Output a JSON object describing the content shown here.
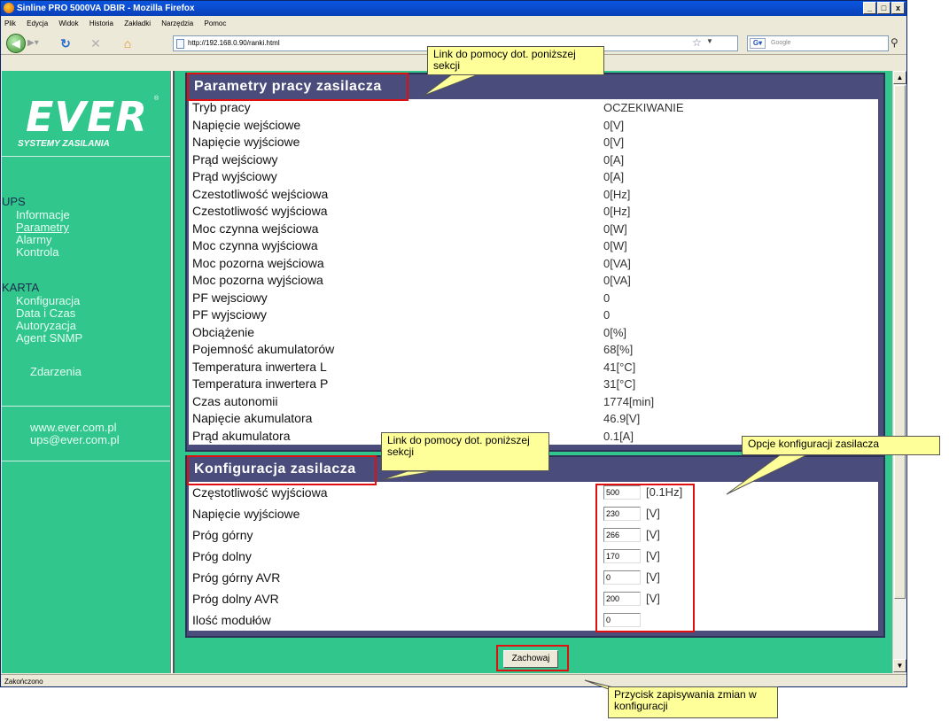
{
  "window": {
    "title": "Sinline PRO 5000VA DBIR - Mozilla Firefox",
    "controls": [
      "_",
      "□",
      "x"
    ]
  },
  "menu": [
    "Plik",
    "Edycja",
    "Widok",
    "Historia",
    "Zakładki",
    "Narzędzia",
    "Pomoc"
  ],
  "nav": {
    "url": "http://192.168.0.90/ranki.html",
    "search_placeholder": "Google"
  },
  "sidebar": {
    "logo": "EVER",
    "logo_mark": "®",
    "tagline": "SYSTEMY ZASILANIA",
    "ups_heading": "UPS",
    "ups_items": [
      "Informacje",
      "Parametry",
      "Alarmy",
      "Kontrola"
    ],
    "karta_heading": "KARTA",
    "karta_items": [
      "Konfiguracja",
      "Data i Czas",
      "Autoryzacja",
      "Agent SNMP"
    ],
    "events": "Zdarzenia",
    "website": "www.ever.com.pl",
    "email": "ups@ever.com.pl"
  },
  "params_panel": {
    "title": "Parametry pracy zasilacza",
    "rows": [
      {
        "label": "Tryb pracy",
        "value": "OCZEKIWANIE"
      },
      {
        "label": "Napięcie wejściowe",
        "value": "0[V]"
      },
      {
        "label": "Napięcie wyjściowe",
        "value": "0[V]"
      },
      {
        "label": "Prąd wejściowy",
        "value": "0[A]"
      },
      {
        "label": "Prąd wyjściowy",
        "value": "0[A]"
      },
      {
        "label": "Czestotliwość wejściowa",
        "value": "0[Hz]"
      },
      {
        "label": "Czestotliwość wyjściowa",
        "value": "0[Hz]"
      },
      {
        "label": "Moc czynna wejściowa",
        "value": "0[W]"
      },
      {
        "label": "Moc czynna wyjściowa",
        "value": "0[W]"
      },
      {
        "label": "Moc pozorna wejściowa",
        "value": "0[VA]"
      },
      {
        "label": "Moc pozorna wyjściowa",
        "value": "0[VA]"
      },
      {
        "label": "PF wejsciowy",
        "value": "0"
      },
      {
        "label": "PF wyjsciowy",
        "value": "0"
      },
      {
        "label": "Obciążenie",
        "value": "0[%]"
      },
      {
        "label": "Pojemność akumulatorów",
        "value": "68[%]"
      },
      {
        "label": "Temperatura inwertera L",
        "value": "41[°C]"
      },
      {
        "label": "Temperatura inwertera P",
        "value": "31[°C]"
      },
      {
        "label": "Czas autonomii",
        "value": "1774[min]"
      },
      {
        "label": "Napięcie akumulatora",
        "value": "46.9[V]"
      },
      {
        "label": "Prąd akumulatora",
        "value": "0.1[A]"
      }
    ]
  },
  "config_panel": {
    "title": "Konfiguracja zasilacza",
    "rows": [
      {
        "label": "Częstotliwość wyjściowa",
        "value": "500",
        "unit": "[0.1Hz]"
      },
      {
        "label": "Napięcie wyjściowe",
        "value": "230",
        "unit": "[V]"
      },
      {
        "label": "Próg górny",
        "value": "266",
        "unit": "[V]"
      },
      {
        "label": "Próg dolny",
        "value": "170",
        "unit": "[V]"
      },
      {
        "label": "Próg górny AVR",
        "value": "0",
        "unit": "[V]"
      },
      {
        "label": "Próg dolny AVR",
        "value": "200",
        "unit": "[V]"
      },
      {
        "label": "Ilość modułów",
        "value": "0",
        "unit": ""
      }
    ],
    "save_label": "Zachowaj"
  },
  "status": "Zakończono",
  "callouts": {
    "help_params": "Link do pomocy dot. poniższej sekcji",
    "help_config": "Link do pomocy dot. poniższej sekcji",
    "config_options": "Opcje konfiguracji zasilacza",
    "save_note": "Przycisk zapisywania zmian w konfiguracji"
  }
}
